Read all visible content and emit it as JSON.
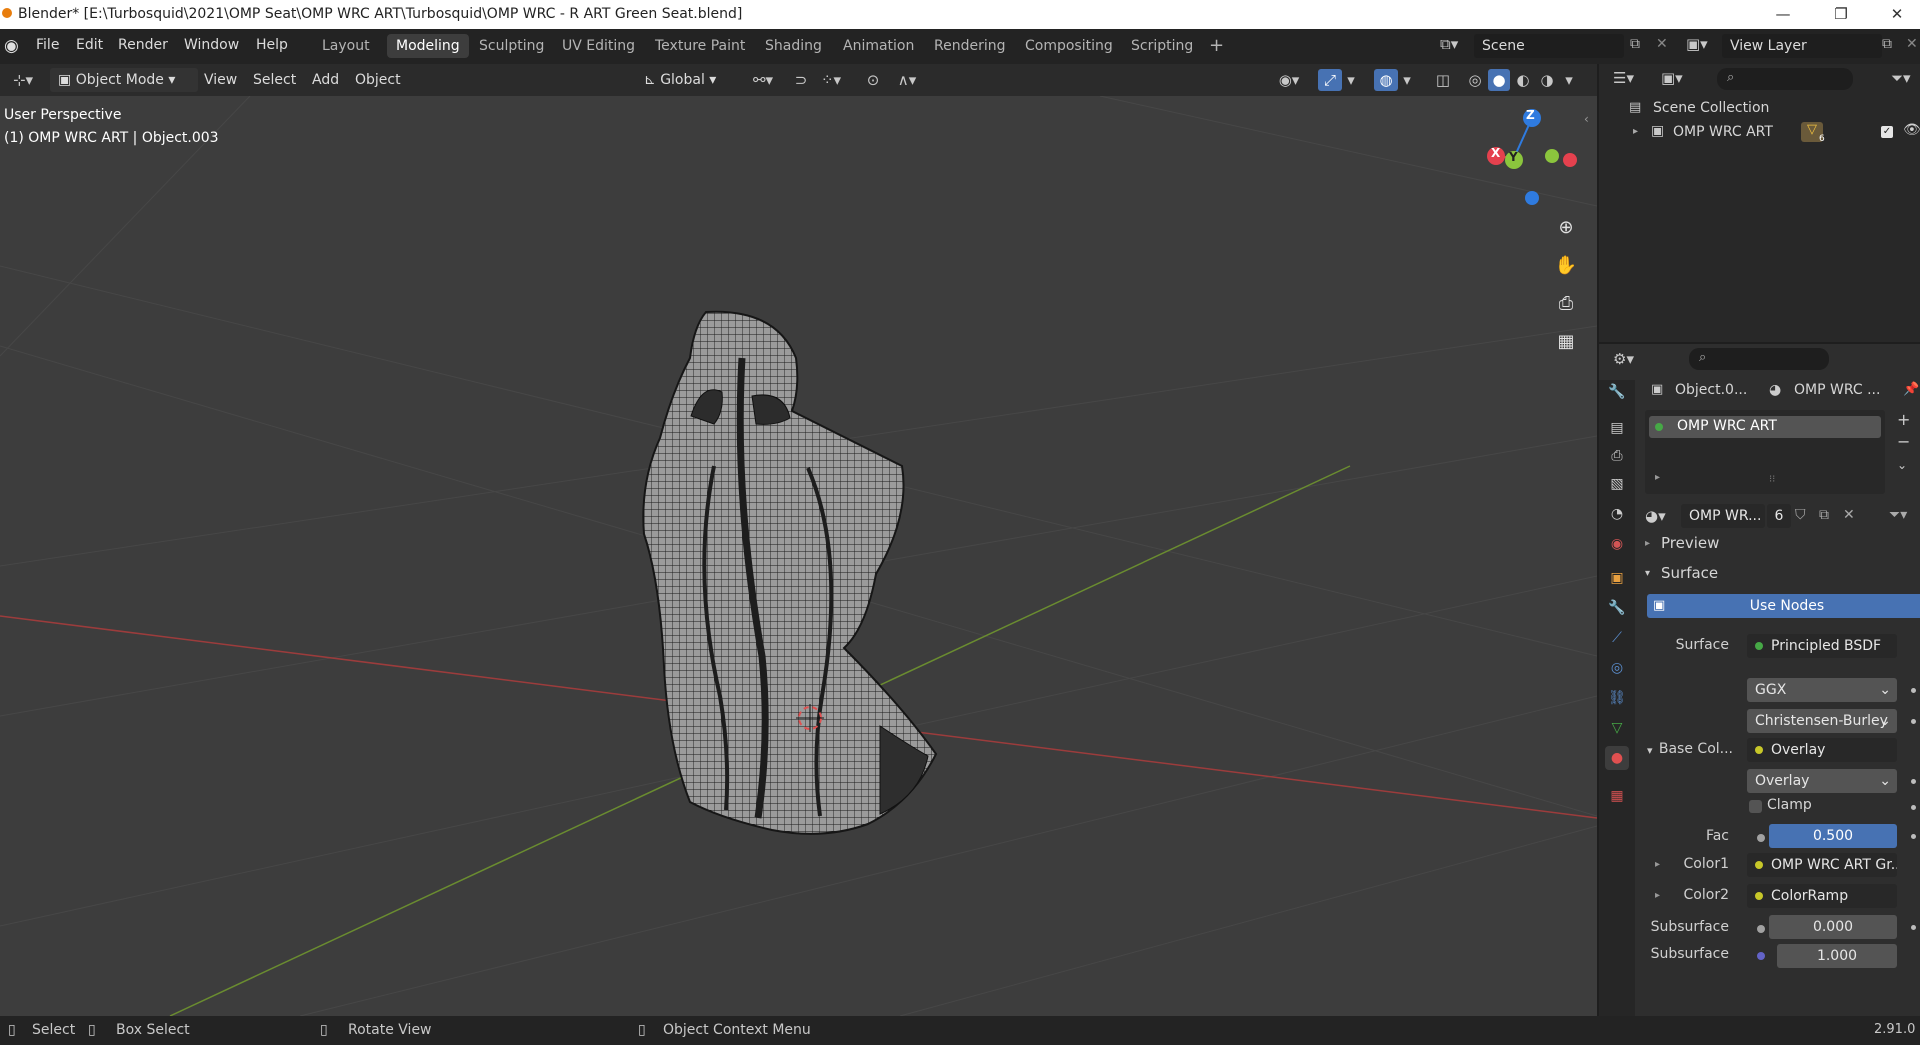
{
  "window": {
    "title": "Blender* [E:\\Turbosquid\\2021\\OMP Seat\\OMP WRC ART\\Turbosquid\\OMP WRC - R ART Green Seat.blend]"
  },
  "menu": [
    "File",
    "Edit",
    "Render",
    "Window",
    "Help"
  ],
  "workspaces": [
    "Layout",
    "Modeling",
    "Sculpting",
    "UV Editing",
    "Texture Paint",
    "Shading",
    "Animation",
    "Rendering",
    "Compositing",
    "Scripting"
  ],
  "active_workspace": "Modeling",
  "scene": "Scene",
  "view_layer": "View Layer",
  "header": {
    "mode": "Object Mode",
    "items": [
      "View",
      "Select",
      "Add",
      "Object"
    ],
    "transform_orientation": "Global"
  },
  "viewport": {
    "perspective": "User Perspective",
    "object_info": "(1) OMP WRC ART | Object.003",
    "axes": {
      "x": "X",
      "y": "Y",
      "z": "Z"
    }
  },
  "outliner": {
    "root": "Scene Collection",
    "collection": "OMP WRC ART",
    "badge_count": "6"
  },
  "properties": {
    "object_name": "Object.0...",
    "material_short": "OMP WRC ...",
    "slot_name": "OMP WRC ART",
    "material_field": "OMP WR...",
    "user_count": "6",
    "panels": {
      "preview": "Preview",
      "surface": "Surface"
    },
    "use_nodes": "Use Nodes",
    "rows": {
      "surface_label": "Surface",
      "surface_value": "Principled BSDF",
      "distribution": "GGX",
      "subsurface_method": "Christensen-Burley",
      "base_color_label": "Base Col...",
      "base_color_value": "Overlay",
      "blend_mode": "Overlay",
      "clamp": "Clamp",
      "fac_label": "Fac",
      "fac_value": "0.500",
      "color1_label": "Color1",
      "color1_value": "OMP WRC ART Gr...",
      "color2_label": "Color2",
      "color2_value": "ColorRamp",
      "subsurface_label": "Subsurface",
      "subsurface_value": "0.000",
      "subsurface2_label": "Subsurface",
      "subsurface2_value": "1.000"
    }
  },
  "statusbar": {
    "select": "Select",
    "box_select": "Box Select",
    "rotate_view": "Rotate View",
    "context_menu": "Object Context Menu",
    "version": "2.91.0"
  },
  "colors": {
    "accent_blue": "#4772b3",
    "active_green": "#46a846",
    "socket_yellow": "#c7c729",
    "socket_gray": "#a1a1a1",
    "axis_x": "#e5414e",
    "axis_y": "#8bc53d",
    "axis_z": "#2f7bdf"
  }
}
